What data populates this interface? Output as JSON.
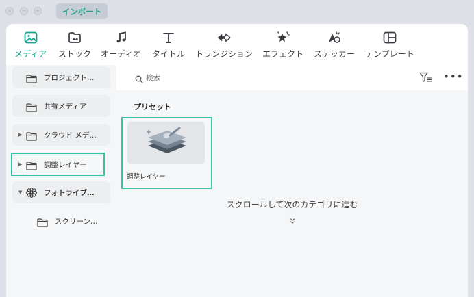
{
  "titlebar": {
    "import_label": "インポート"
  },
  "tabs": [
    {
      "label": "メディア",
      "icon": "media-icon",
      "active": true
    },
    {
      "label": "ストック",
      "icon": "stock-icon"
    },
    {
      "label": "オーディオ",
      "icon": "music-note-icon"
    },
    {
      "label": "タイトル",
      "icon": "title-t-icon"
    },
    {
      "label": "トランジション",
      "icon": "transition-icon"
    },
    {
      "label": "エフェクト",
      "icon": "effect-icon"
    },
    {
      "label": "ステッカー",
      "icon": "sticker-icon"
    },
    {
      "label": "テンプレート",
      "icon": "template-icon"
    }
  ],
  "sidebar": {
    "items": [
      {
        "label": "プロジェクト…",
        "icon": "folder-icon"
      },
      {
        "label": "共有メディア",
        "icon": "folder-icon"
      },
      {
        "label": "クラウド メデ…",
        "icon": "folder-icon",
        "expandable": true
      },
      {
        "label": "調整レイヤー",
        "icon": "folder-icon",
        "expandable": true,
        "highlighted": true
      },
      {
        "label": "フォトライブ…",
        "icon": "flower-icon",
        "expanded": true
      },
      {
        "label": "スクリーン…",
        "icon": "folder-icon",
        "child": true
      }
    ]
  },
  "search": {
    "placeholder": "検索"
  },
  "main": {
    "section_title": "プリセット",
    "card_label": "調整レイヤー",
    "scroll_hint": "スクロールして次のカテゴリに進む"
  },
  "colors": {
    "accent": "#12a38a",
    "highlight_border": "#34c2a3"
  }
}
